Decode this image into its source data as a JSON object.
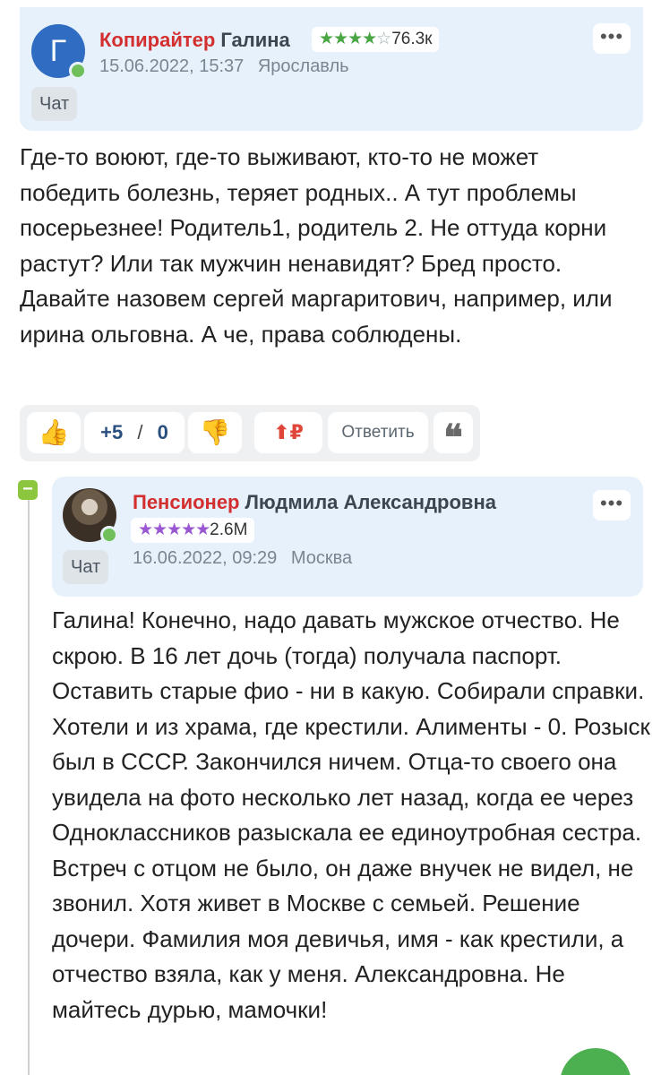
{
  "comment": {
    "avatar_letter": "Г",
    "rank": "Копирайтер",
    "name": "Галина",
    "stars": "★★★★",
    "star_empty": "☆",
    "rating": "76.3к",
    "date": "15.06.2022, 15:37",
    "city": "Ярославль",
    "chat_label": "Чат",
    "more_label": "•••",
    "text": "Где-то воюют, где-то выживают, кто-то не может победить болезнь, теряет родных.. А тут проблемы посерьезнее! Родитель1, родитель 2. Не оттуда корни растут? Или так мужчин ненавидят? Бред просто. Давайте назовем сергей маргаритович, например, или ирина ольговна. А че, права соблюдены.",
    "actions": {
      "like_icon": "thumbs-up",
      "plus": "+5",
      "slash": "/",
      "minus": "0",
      "dislike_icon": "thumbs-down",
      "donate": "⬆₽",
      "reply_label": "Ответить",
      "quote_icon": "❝"
    }
  },
  "reply": {
    "collapse_label": "−",
    "rank": "Пенсионер",
    "name": "Людмила Александровна",
    "stars": "★★★★★",
    "rating": "2.6M",
    "date": "16.06.2022, 09:29",
    "city": "Москва",
    "chat_label": "Чат",
    "more_label": "•••",
    "text": "Галина! Конечно, надо давать мужское отчество. Не скрою. В 16 лет дочь (тогда) получала паспорт. Оставить старые фио - ни в какую. Собирали справки. Хотели и из храма, где крестили. Алименты - 0. Розыск был в СССР. Закончился ничем. Отца-то своего она увидела на фото несколько лет назад, когда ее через Одноклассников разыскала ее единоутробная сестра. Встреч с отцом не было, он даже внучек не видел, не звонил. Хотя живет в Москве с семьей. Решение дочери. Фамилия моя девичья, имя - как крестили, а отчество взяла, как у меня. Александровна. Не майтесь дурью, мамочки!"
  },
  "colors": {
    "header_bg": "#e6f1fb",
    "rank": "#d32f2f",
    "online": "#6fbf5a",
    "like": "#f2a31b",
    "score": "#2a4f7f",
    "fab": "#4cb050"
  }
}
